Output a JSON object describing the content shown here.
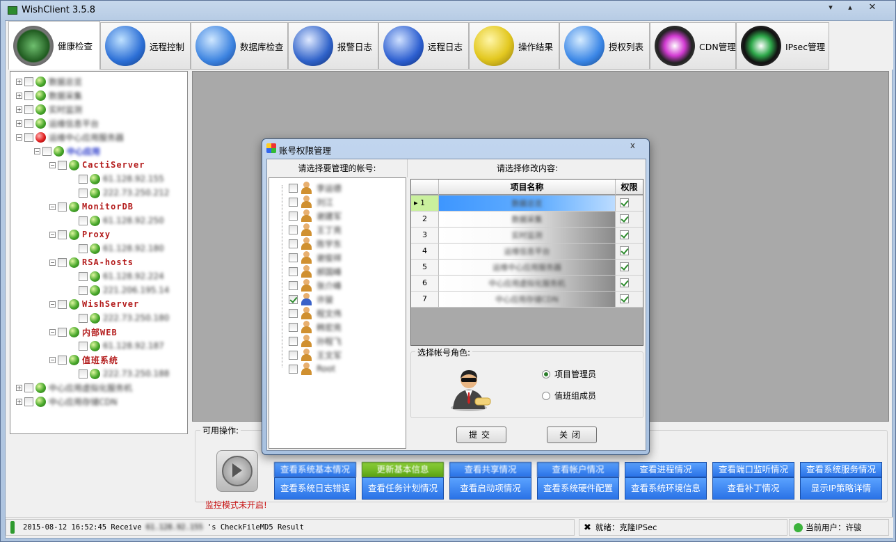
{
  "window": {
    "title": "WishClient",
    "version": "3.5.8"
  },
  "tabs": [
    {
      "label": "健康检查",
      "icon": "radar-icon"
    },
    {
      "label": "远程控制",
      "icon": "globe-icon"
    },
    {
      "label": "数据库检查",
      "icon": "database-icon"
    },
    {
      "label": "报警日志",
      "icon": "megaphone-icon"
    },
    {
      "label": "远程日志",
      "icon": "wrench-globe-icon"
    },
    {
      "label": "操作结果",
      "icon": "alarm-clock-icon"
    },
    {
      "label": "授权列表",
      "icon": "globe-box-icon"
    },
    {
      "label": "CDN管理",
      "icon": "yin-yang-icon"
    },
    {
      "label": "IPsec管理",
      "icon": "yin-yang-green-icon"
    }
  ],
  "tree": {
    "top_items": [
      "数据总览",
      "数据采集",
      "实时监测",
      "运维信息平台",
      "运维中心应用服务器"
    ],
    "group": "中心应用",
    "servers": [
      {
        "name": "CactiServer",
        "ips": [
          "61.128.92.155",
          "222.73.250.212"
        ]
      },
      {
        "name": "MonitorDB",
        "ips": [
          "61.128.92.250"
        ]
      },
      {
        "name": "Proxy",
        "ips": [
          "61.128.92.180"
        ]
      },
      {
        "name": "RSA-hosts",
        "ips": [
          "61.128.92.224",
          "221.206.195.14"
        ]
      },
      {
        "name": "WishServer",
        "ips": [
          "222.73.250.180"
        ]
      },
      {
        "name": "内部WEB",
        "ips": [
          "61.128.92.187"
        ]
      },
      {
        "name": "值班系统",
        "ips": [
          "222.73.250.188"
        ]
      }
    ],
    "bottom_items": [
      "中心应用虚拟化服务机",
      "中心应用存储CDN"
    ]
  },
  "ops": {
    "label": "可用操作:",
    "monitor_status": "监控模式未开启!",
    "row1": [
      "查看系统基本情况",
      "更新基本信息",
      "查看共享情况",
      "查看帐户情况",
      "查看进程情况",
      "查看端口监听情况",
      "查看系统服务情况"
    ],
    "row2": [
      "查看系统日志错误",
      "查看任务计划情况",
      "查看启动项情况",
      "查看系统硬件配置",
      "查看系统环境信息",
      "查看补丁情况",
      "显示IP策略详情"
    ]
  },
  "status": {
    "message_prefix": "2015-08-12 16:52:45  Receive",
    "message_ip": "61.128.92.155",
    "message_suffix": "'s CheckFileMD5 Result",
    "ready": "就绪：克隆IPSec",
    "user": "当前用户：许骏"
  },
  "dialog": {
    "title": "账号权限管理",
    "close": "x",
    "accounts_header": "请选择要管理的帐号:",
    "content_header": "请选择修改内容:",
    "accounts": [
      {
        "name": "李运德",
        "checked": false
      },
      {
        "name": "刘江",
        "checked": false
      },
      {
        "name": "谢建军",
        "checked": false
      },
      {
        "name": "王丁亮",
        "checked": false
      },
      {
        "name": "陈宇东",
        "checked": false
      },
      {
        "name": "谢俊祥",
        "checked": false
      },
      {
        "name": "郝国峰",
        "checked": false
      },
      {
        "name": "张介峰",
        "checked": false
      },
      {
        "name": "许骏",
        "checked": true
      },
      {
        "name": "程文伟",
        "checked": false
      },
      {
        "name": "韩宏亮",
        "checked": false
      },
      {
        "name": "孙程飞",
        "checked": false
      },
      {
        "name": "王文军",
        "checked": false
      },
      {
        "name": "Root",
        "checked": false
      }
    ],
    "grid": {
      "col_name": "项目名称",
      "col_perm": "权限",
      "rows": [
        {
          "num": "1",
          "name": "数据总览",
          "perm": true
        },
        {
          "num": "2",
          "name": "数据采集",
          "perm": true
        },
        {
          "num": "3",
          "name": "实时监测",
          "perm": true
        },
        {
          "num": "4",
          "name": "运维信息平台",
          "perm": true
        },
        {
          "num": "5",
          "name": "运维中心应用服务器",
          "perm": true
        },
        {
          "num": "6",
          "name": "中心应用虚拟化服务机",
          "perm": true
        },
        {
          "num": "7",
          "name": "中心应用存储CDN",
          "perm": true
        }
      ]
    },
    "role_label": "选择帐号角色:",
    "roles": [
      {
        "label": "项目管理员",
        "selected": true
      },
      {
        "label": "值班组成员",
        "selected": false
      }
    ],
    "submit": "提交",
    "close_button": "关闭"
  }
}
